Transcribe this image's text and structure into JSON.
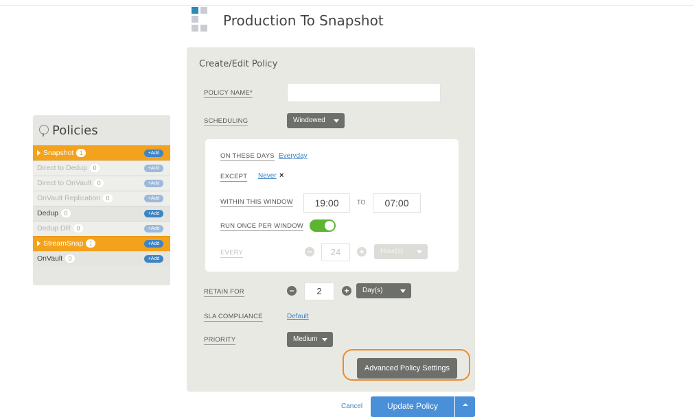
{
  "header": {
    "title": "Production To Snapshot"
  },
  "policies": {
    "title": "Policies",
    "add_label": "+Add",
    "items": [
      {
        "label": "Snapshot",
        "count": "1",
        "state": "active"
      },
      {
        "label": "Direct to Dedup",
        "count": "0",
        "state": "disabled"
      },
      {
        "label": "Direct to OnVault",
        "count": "0",
        "state": "disabled"
      },
      {
        "label": "OnVault Replication",
        "count": "0",
        "state": "disabled"
      },
      {
        "label": "Dedup",
        "count": "0",
        "state": "enabled"
      },
      {
        "label": "Dedup DR",
        "count": "0",
        "state": "disabled"
      },
      {
        "label": "StreamSnap",
        "count": "1",
        "state": "active"
      },
      {
        "label": "OnVault",
        "count": "0",
        "state": "enabled"
      }
    ]
  },
  "form": {
    "title": "Create/Edit Policy",
    "policy_name_label": "POLICY NAME*",
    "policy_name_value": "",
    "scheduling_label": "SCHEDULING",
    "scheduling_value": "Windowed",
    "on_these_days_label": "ON THESE DAYS",
    "on_these_days_value": "Everyday",
    "except_label": "EXCEPT",
    "except_value": "Never",
    "except_clear": "×",
    "window_label": "WITHIN THIS WINDOW",
    "window_start": "19:00",
    "window_to": "TO",
    "window_end": "07:00",
    "run_once_label": "RUN ONCE PER WINDOW",
    "run_once_enabled": true,
    "every_label": "EVERY",
    "every_value": "24",
    "every_unit": "Hour(s)",
    "retain_label": "RETAIN FOR",
    "retain_value": "2",
    "retain_unit": "Day(s)",
    "sla_label": "SLA COMPLIANCE",
    "sla_value": "Default",
    "priority_label": "PRIORITY",
    "priority_value": "Medium",
    "advanced_button": "Advanced Policy Settings"
  },
  "footer": {
    "cancel": "Cancel",
    "update": "Update Policy"
  },
  "colors": {
    "accent_orange": "#f3a21d",
    "highlight_ring": "#f08a23",
    "primary_blue": "#4a90d9",
    "toggle_green": "#5cb531"
  }
}
